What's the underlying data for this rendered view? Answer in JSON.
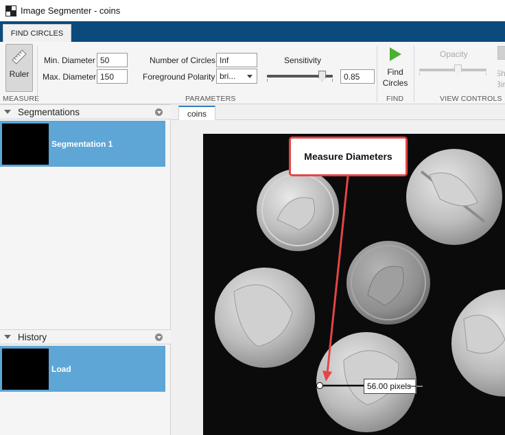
{
  "window": {
    "title": "Image Segmenter - coins"
  },
  "tabs": {
    "active": "FIND CIRCLES"
  },
  "toolstrip": {
    "measure": {
      "ruler_label": "Ruler",
      "section": "MEASURE"
    },
    "parameters": {
      "min_diameter_label": "Min. Diameter",
      "min_diameter_value": "50",
      "max_diameter_label": "Max. Diameter",
      "max_diameter_value": "150",
      "num_circles_label": "Number of Circles",
      "num_circles_value": "Inf",
      "polarity_label": "Foreground Polarity",
      "polarity_value": "bri...",
      "sensitivity_label": "Sensitivity",
      "sensitivity_value": "0.85",
      "sensitivity_level": 0.85,
      "section": "PARAMETERS"
    },
    "find": {
      "button_label_1": "Find",
      "button_label_2": "Circles",
      "section": "FIND"
    },
    "view_controls": {
      "opacity_label": "Opacity",
      "opacity_level": 0.5,
      "show_label_1": "Sh",
      "show_label_2": "Bir",
      "section": "VIEW CONTROLS"
    }
  },
  "segmentations": {
    "title": "Segmentations",
    "items": [
      {
        "label": "Segmentation 1"
      }
    ]
  },
  "history": {
    "title": "History",
    "items": [
      {
        "label": "Load"
      }
    ]
  },
  "document": {
    "tab": "coins"
  },
  "annotation": {
    "callout": "Measure Diameters",
    "measurement": "56.00 pixels"
  },
  "colors": {
    "accent": "#0b4a7d",
    "selection": "#5ea6d6",
    "callout": "#e64545",
    "find": "#4caf32"
  }
}
